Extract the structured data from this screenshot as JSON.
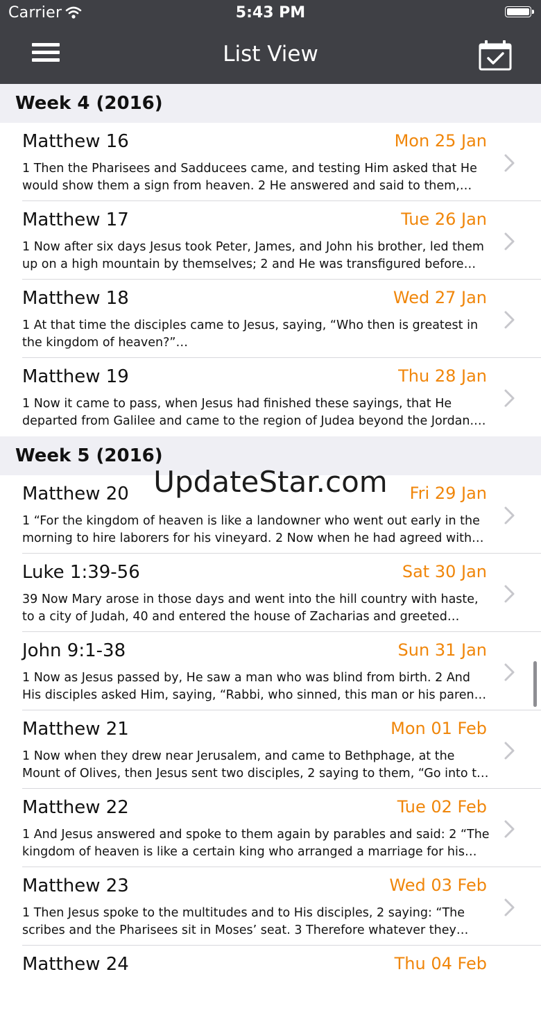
{
  "status_bar": {
    "carrier": "Carrier",
    "time": "5:43 PM"
  },
  "nav": {
    "title": "List View",
    "left_icon": "menu-icon",
    "right_icon": "calendar-check-icon"
  },
  "colors": {
    "nav_bg": "#3f4045",
    "date_accent": "#f0860a",
    "section_bg": "#efeff4"
  },
  "sections": [
    {
      "header": "Week 4 (2016)",
      "rows": [
        {
          "title": "Matthew 16",
          "date": "Mon 25 Jan",
          "excerpt": "1 Then the Pharisees and Sadducees came, and testing Him asked that He would show them a sign from heaven. 2 He answered and said to them, “W…"
        },
        {
          "title": "Matthew 17",
          "date": "Tue 26 Jan",
          "excerpt": "1 Now after six days Jesus took Peter, James, and John his brother, led them up on a high mountain by themselves; 2 and He was transfigured before th…"
        },
        {
          "title": "Matthew 18",
          "date": "Wed 27 Jan",
          "excerpt": "1 At that time the disciples came to Jesus, saying, “Who then is greatest in the kingdom of heaven?”…"
        },
        {
          "title": "Matthew 19",
          "date": "Thu 28 Jan",
          "excerpt": "1 Now it came to pass, when Jesus had finished these sayings, that He departed from Galilee and came to the region of Judea beyond the Jordan.…"
        }
      ]
    },
    {
      "header": "Week 5 (2016)",
      "rows": [
        {
          "title": "Matthew 20",
          "date": "Fri 29 Jan",
          "excerpt": "1 “For the kingdom of heaven is like a landowner who went out early in the morning to hire laborers for his vineyard. 2 Now when he had agreed with t…"
        },
        {
          "title": "Luke 1:39-56",
          "date": "Sat 30 Jan",
          "excerpt": "39 Now Mary arose in those days and went into the hill country with haste, to a city of Judah, 40 and entered the house of Zacharias and greeted Eliza…"
        },
        {
          "title": "John 9:1-38",
          "date": "Sun 31 Jan",
          "excerpt": "1 Now as Jesus passed by, He saw a man who was blind from birth. 2 And His disciples asked Him, saying, “Rabbi, who sinned, this man or his parents, tha…"
        },
        {
          "title": "Matthew 21",
          "date": "Mon 01 Feb",
          "excerpt": "1 Now when they drew near Jerusalem, and came to Bethphage, at the Mount of Olives, then Jesus sent two disciples, 2 saying to them, “Go into t…"
        },
        {
          "title": "Matthew 22",
          "date": "Tue 02 Feb",
          "excerpt": "1 And Jesus answered and spoke to them again by parables and said: 2 “The kingdom of heaven is like a certain king who arranged a marriage for his so…"
        },
        {
          "title": "Matthew 23",
          "date": "Wed 03 Feb",
          "excerpt": "1 Then Jesus spoke to the multitudes and to His disciples, 2 saying: “The scribes and the Pharisees sit in Moses’ seat. 3 Therefore whatever they tell…"
        },
        {
          "title": "Matthew 24",
          "date": "Thu 04 Feb",
          "excerpt": ""
        }
      ]
    }
  ],
  "watermark": "UpdateStar.com"
}
